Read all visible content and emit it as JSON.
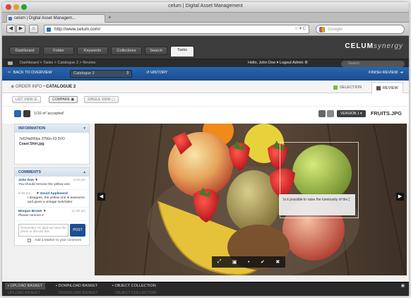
{
  "window": {
    "title": "celum | Digital Asset Management"
  },
  "browser": {
    "tab_title": "celum | Digital Asset Managem...",
    "url": "http://www.celum.com/",
    "search_placeholder": "Google"
  },
  "app": {
    "menu_tabs": [
      "Dashboard",
      "Folder",
      "Keywords",
      "Collections",
      "Search",
      "Tasks"
    ],
    "active_tab": "Tasks",
    "logo_text": "CELUM",
    "logo_suffix": "synergy",
    "breadcrumb": "Dashboard  >  Tasks  >  Catalogue 2  >  Review",
    "user_line": "Hello, John Doe ▾    Logout    Admin ⚙",
    "search_placeholder": "Search"
  },
  "toolbar": {
    "back_label": "BACK TO OVERVIEW",
    "catalogue_select": "Catalogue 2",
    "history_label": "HISTORY",
    "finish_label": "FINISH REVIEW"
  },
  "order": {
    "prefix": "ORDER INFO",
    "separator": "•",
    "title": "CATALOGUE 2",
    "tab_selection": "SELECTION",
    "tab_review": "REVIEW"
  },
  "views": {
    "list": "LIST VIEW",
    "compare": "COMPARE",
    "single": "SINGLE VIEW"
  },
  "status": {
    "accepted": "1/10 of 'accepted'",
    "version": "VERSION 1",
    "filename": "FRUITS.JPG"
  },
  "information": {
    "header": "INFORMATION",
    "line1": "7e624a000ps 3756n-X3 5VO",
    "line2": "Coast Shirt.jpg"
  },
  "comments": {
    "header": "COMMENTS",
    "items": [
      {
        "author": "John Doe",
        "time": "4:45 pm",
        "text": "You should remove the yellow one"
      },
      {
        "author": "David Applesend",
        "time": "8:45 pm",
        "text": "I disagree, the yellow one is awesome and gives a vintage look/older"
      },
      {
        "author": "Morgan Brown",
        "time": "11:45 am",
        "text": "Please remove it"
      }
    ],
    "input_placeholder": "Remember I'm glad we have the photo to discuss this",
    "post_label": "POST",
    "marker_label": "Add a Marker to your comment"
  },
  "annotation": {
    "text": "Is it possible to raise the luminosity of the ["
  },
  "viewer_tools": [
    "expand-icon",
    "fit-icon",
    "dot-icon",
    "check-icon",
    "close-icon"
  ],
  "bottom": {
    "items": [
      "UPLOAD BASKET",
      "DOWNLOAD BASKET",
      "OBJECT COLLECTION"
    ]
  },
  "colors": {
    "accent_blue": "#1c4e90",
    "header_dark": "#3c3c3c",
    "review_green": "#6fbf3a"
  }
}
